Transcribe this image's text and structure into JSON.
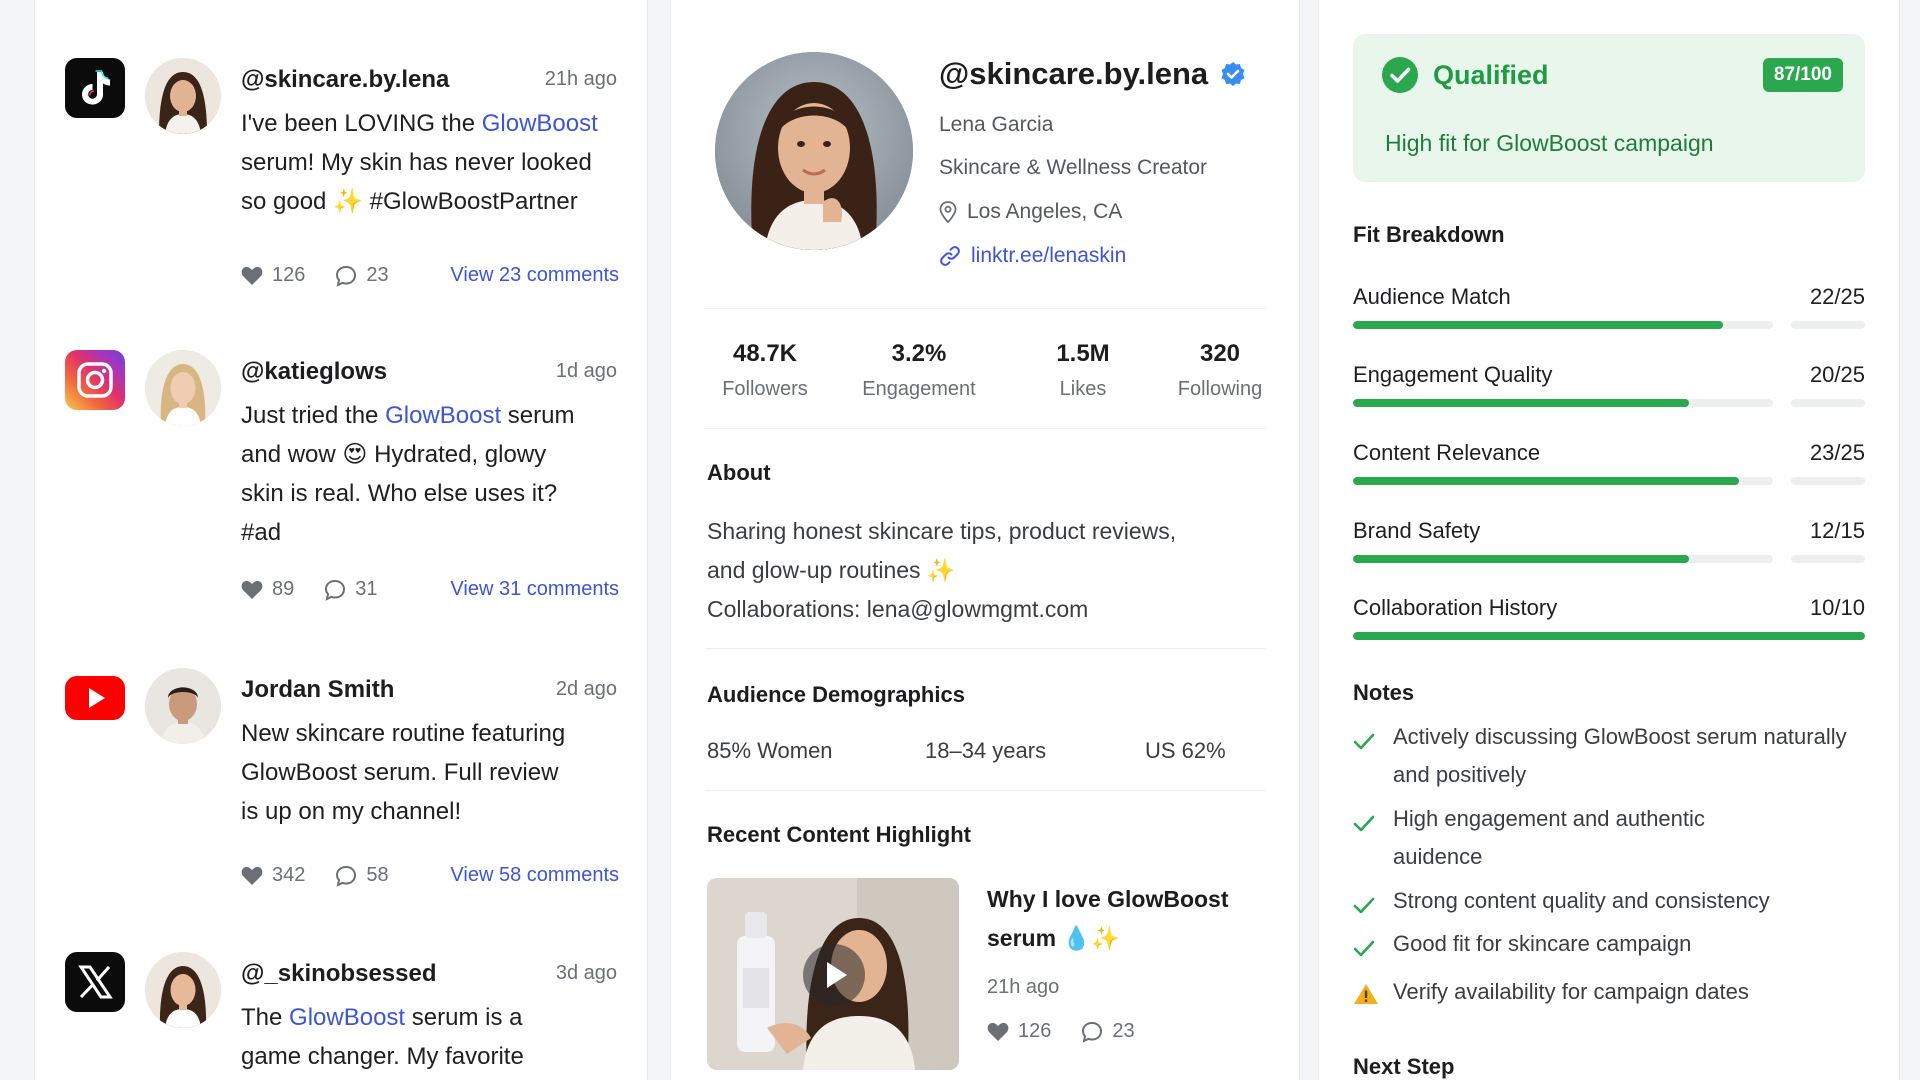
{
  "feed": {
    "posts": [
      {
        "platform": "tiktok-icon",
        "user": "@skincare.by.lena",
        "time": "21h ago",
        "text_parts": [
          "I've been LOVING the ",
          "GlowBoost",
          " serum! My skin has never looked so good ✨ #GlowBoostPartner"
        ],
        "likes": "126",
        "comments": "23",
        "view_label": "View 23 comments"
      },
      {
        "platform": "instagram-icon",
        "user": "@katieglows",
        "time": "1d ago",
        "text_parts": [
          "Just tried the ",
          "GlowBoost",
          " serum and wow 😍 Hydrated, glowy skin is real. Who else uses it? #ad"
        ],
        "likes": "89",
        "comments": "31",
        "view_label": "View 31 comments"
      },
      {
        "platform": "youtube-icon",
        "user": "Jordan Smith",
        "time": "2d ago",
        "text_parts": [
          "New skincare routine featuring GlowBoost serum. Full review is up on my channel!",
          "",
          ""
        ],
        "likes": "342",
        "comments": "58",
        "view_label": "View 58 comments"
      },
      {
        "platform": "x-icon",
        "user": "@_skinobsessed",
        "time": "3d ago",
        "text_parts": [
          "The ",
          "GlowBoost",
          " serum is a game changer. My favorite"
        ],
        "likes": "",
        "comments": "",
        "view_label": ""
      }
    ]
  },
  "profile": {
    "handle": "@skincare.by.lena",
    "name": "Lena Garcia",
    "role": "Skincare & Wellness Creator",
    "location": "Los Angeles, CA",
    "link": "linktr.ee/lenaskin",
    "stats": [
      {
        "value": "48.7K",
        "label": "Followers"
      },
      {
        "value": "3.2%",
        "label": "Engagement"
      },
      {
        "value": "1.5M",
        "label": "Likes"
      },
      {
        "value": "320",
        "label": "Following"
      }
    ],
    "about_title": "About",
    "about_line1": "Sharing honest skincare tips, product reviews,",
    "about_line2": "and glow-up routines ✨",
    "about_line3": "Collaborations: lena@glowmgmt.com",
    "demographics_title": "Audience Demographics",
    "demographics": [
      "85% Women",
      "18–34 years",
      "US 62%"
    ],
    "highlight_title": "Recent Content Highlight",
    "highlight": {
      "title": "Why I love GlowBoost serum 💧✨",
      "time": "21h ago",
      "likes": "126",
      "comments": "23"
    }
  },
  "fit": {
    "status": "Qualified",
    "score": "87/100",
    "subtitle": "High fit for GlowBoost campaign",
    "breakdown_title": "Fit Breakdown",
    "breakdown": [
      {
        "label": "Audience Match",
        "value": "22/25",
        "fraction": 0.88
      },
      {
        "label": "Engagement Quality",
        "value": "20/25",
        "fraction": 0.8
      },
      {
        "label": "Content Relevance",
        "value": "23/25",
        "fraction": 0.92
      },
      {
        "label": "Brand Safety",
        "value": "12/15",
        "fraction": 0.8
      },
      {
        "label": "Collaboration History",
        "value": "10/10",
        "fraction": 1.0
      }
    ],
    "notes_title": "Notes",
    "notes": [
      {
        "icon": "check-icon",
        "text": "Actively discussing GlowBoost serum naturally and positively"
      },
      {
        "icon": "check-icon",
        "text": "High engagement and authentic auidence"
      },
      {
        "icon": "check-icon",
        "text": "Strong content quality and consistency"
      },
      {
        "icon": "check-icon",
        "text": "Good fit for skincare campaign"
      },
      {
        "icon": "warning-icon",
        "text": "Verify availability for campaign dates"
      }
    ],
    "next_title": "Next Step"
  },
  "colors": {
    "accent_blue": "#3d54d9",
    "success_green": "#2aa74f",
    "verified_blue": "#3b8cf0",
    "warning_yellow": "#f2b01e"
  }
}
